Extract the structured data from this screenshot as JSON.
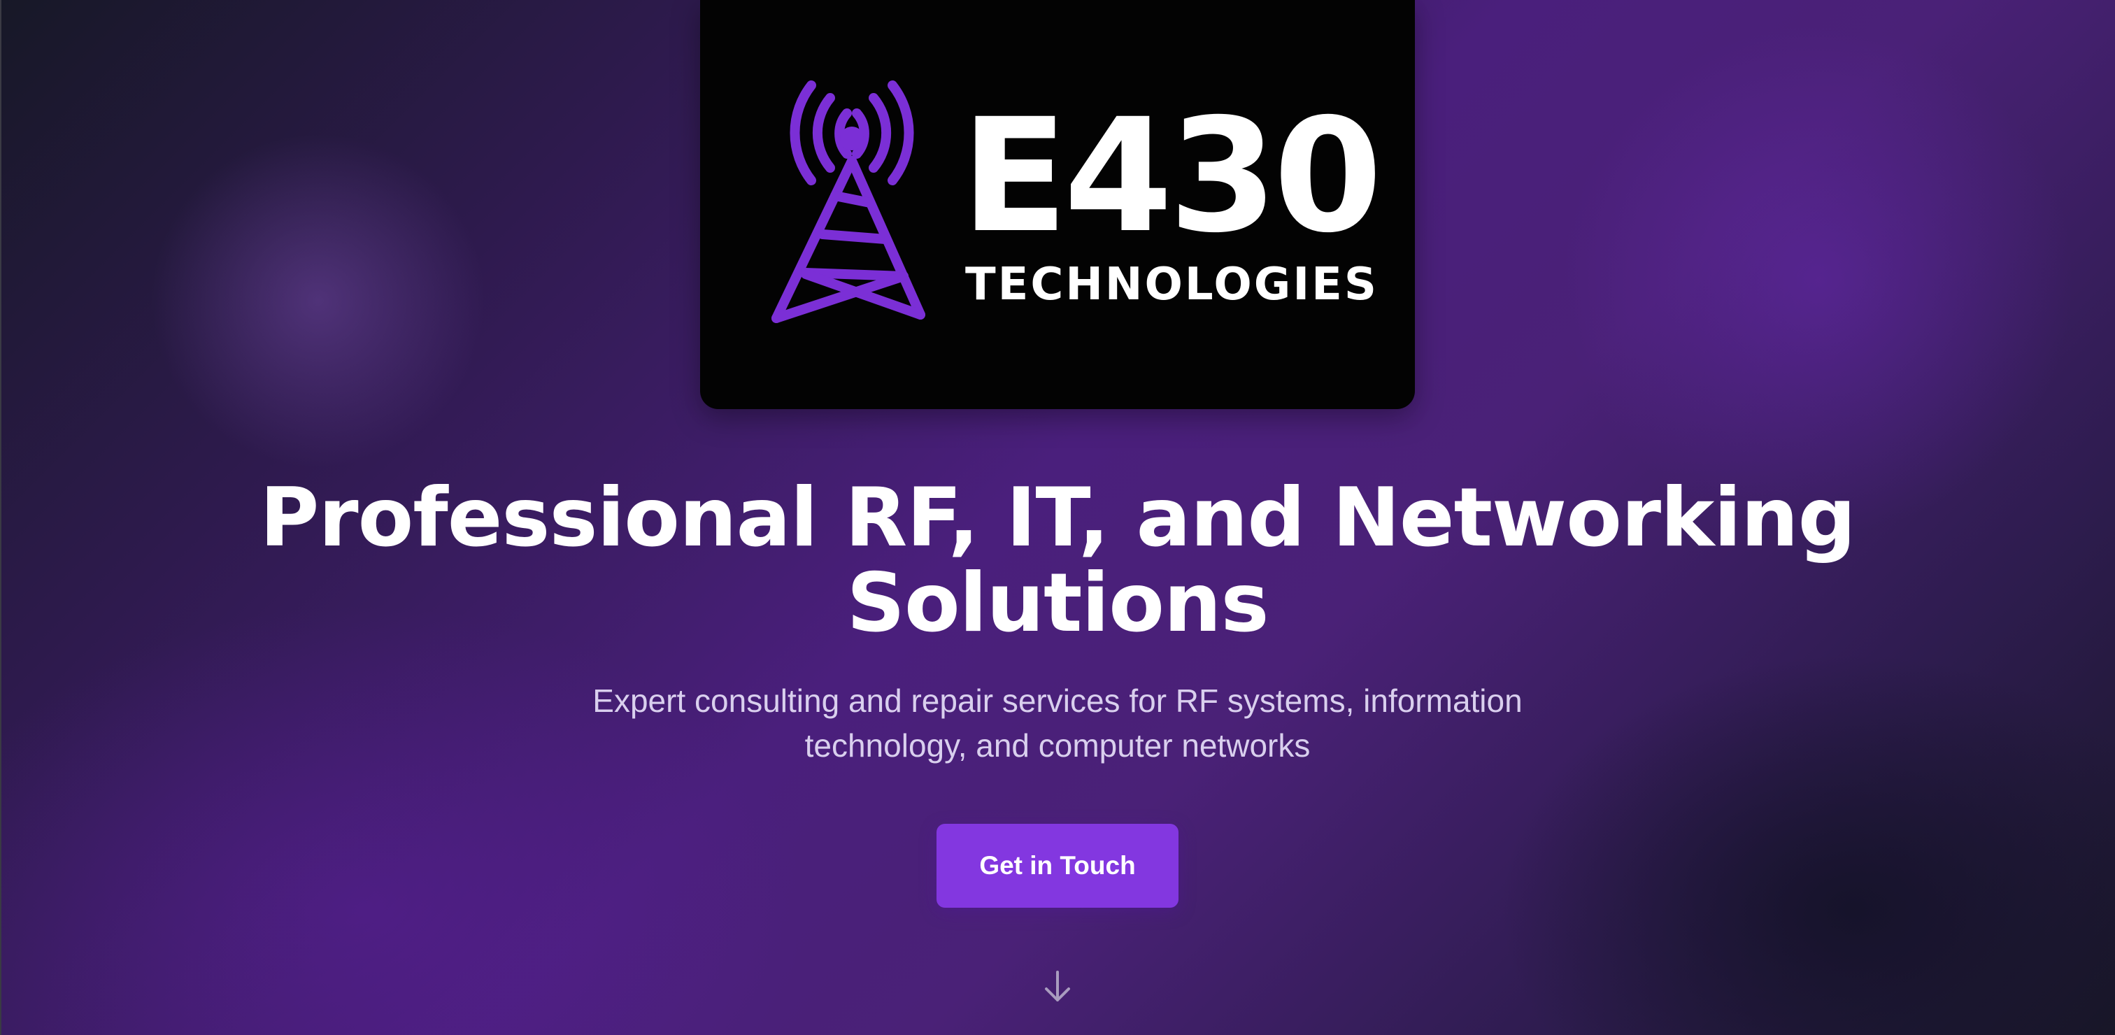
{
  "logo": {
    "brand": "E430",
    "tagline": "TECHNOLOGIES",
    "icon": "radio-tower-icon",
    "accent_color": "#7b2fd6",
    "card_color": "#030303"
  },
  "hero": {
    "headline": "Professional RF, IT, and Networking Solutions",
    "subtitle": "Expert consulting and repair services for RF systems, information technology, and computer networks",
    "cta_label": "Get in Touch",
    "cta_color": "#8337e0",
    "scroll_icon": "arrow-down-icon"
  },
  "theme": {
    "background_primary": "#4a1f7c",
    "background_dark": "#171827",
    "text_color": "#ffffff",
    "subtitle_color": "#d9cfee"
  }
}
